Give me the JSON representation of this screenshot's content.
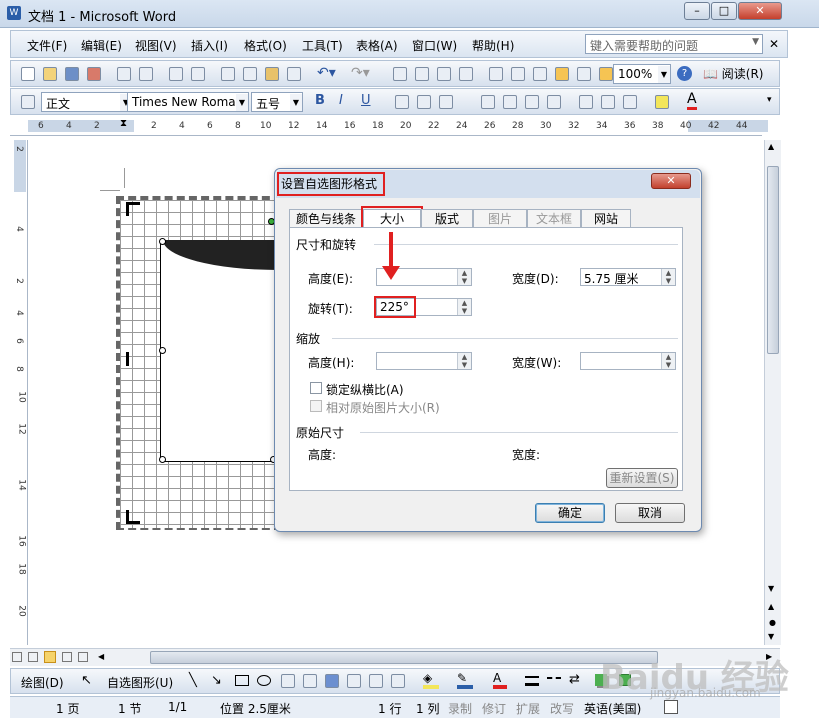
{
  "window": {
    "title": "文档 1 - Microsoft Word"
  },
  "menubar": {
    "items": [
      "文件(F)",
      "编辑(E)",
      "视图(V)",
      "插入(I)",
      "格式(O)",
      "工具(T)",
      "表格(A)",
      "窗口(W)",
      "帮助(H)"
    ],
    "help_placeholder": "键入需要帮助的问题"
  },
  "standard_toolbar": {
    "zoom": "100%",
    "reading": "阅读(R)"
  },
  "formatting_toolbar": {
    "style": "正文",
    "font": "Times New Roman",
    "size": "五号"
  },
  "ruler": {
    "numbers": [
      "6",
      "4",
      "2",
      "2",
      "4",
      "6",
      "8",
      "10",
      "12",
      "14",
      "16",
      "18",
      "20",
      "22",
      "24",
      "26",
      "28",
      "30",
      "32",
      "34",
      "36",
      "38",
      "40",
      "42",
      "44"
    ]
  },
  "vruler": {
    "numbers": [
      "2",
      "4",
      "2",
      "4",
      "6",
      "8",
      "10",
      "12",
      "14",
      "16",
      "18",
      "20"
    ]
  },
  "dialog": {
    "title": "设置自选图形格式",
    "tabs": [
      "颜色与线条",
      "大小",
      "版式",
      "图片",
      "文本框",
      "网站"
    ],
    "section_size": "尺寸和旋转",
    "height_label": "高度(E):",
    "height_value": "",
    "width_label": "宽度(D):",
    "width_value": "5.75 厘米",
    "rotation_label": "旋转(T):",
    "rotation_value": "225°",
    "section_scale": "缩放",
    "scale_height_label": "高度(H):",
    "scale_width_label": "宽度(W):",
    "lock_aspect": "锁定纵横比(A)",
    "relative_original": "相对原始图片大小(R)",
    "section_original": "原始尺寸",
    "orig_height_label": "高度:",
    "orig_width_label": "宽度:",
    "reset": "重新设置(S)",
    "ok": "确定",
    "cancel": "取消"
  },
  "drawbar": {
    "draw": "绘图(D)",
    "autoshapes": "自选图形(U)"
  },
  "statusbar": {
    "page": "1 页",
    "section": "1 节",
    "pages": "1/1",
    "position": "位置 2.5厘米",
    "line": "1 行",
    "column": "1 列",
    "modes": [
      "录制",
      "修订",
      "扩展",
      "改写"
    ],
    "language": "英语(美国)"
  },
  "watermark": {
    "text": "Baidu 经验",
    "url": "jingyan.baidu.com"
  },
  "colors": {
    "highlight": "#e02020",
    "title_bg": "#d3dfee"
  }
}
